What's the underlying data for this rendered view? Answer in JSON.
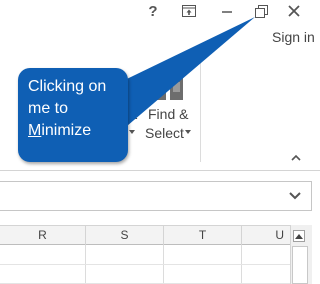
{
  "titlebar": {
    "help_label": "?",
    "help_icon": "help-icon",
    "ribbon_display_icon": "ribbon-display-options-icon",
    "minimize_icon": "minimize-icon",
    "restore_icon": "restore-down-icon",
    "close_icon": "close-icon"
  },
  "account": {
    "sign_in": "Sign in"
  },
  "ribbon": {
    "prev_group_fragment": "&",
    "find_select": {
      "line1": "Find &",
      "line2": "Select",
      "icon": "binoculars-icon"
    },
    "collapse_icon": "chevron-up-icon"
  },
  "formula_bar": {
    "expand_icon": "chevron-down-icon"
  },
  "grid": {
    "columns": [
      "R",
      "S",
      "T",
      "U"
    ],
    "scroll_up_icon": "scroll-up-icon"
  },
  "callout": {
    "line1": "Clicking on",
    "line2": "me to",
    "line3_underlined": "M",
    "line3_rest": "inimize",
    "fill": "#0f5fb4"
  }
}
